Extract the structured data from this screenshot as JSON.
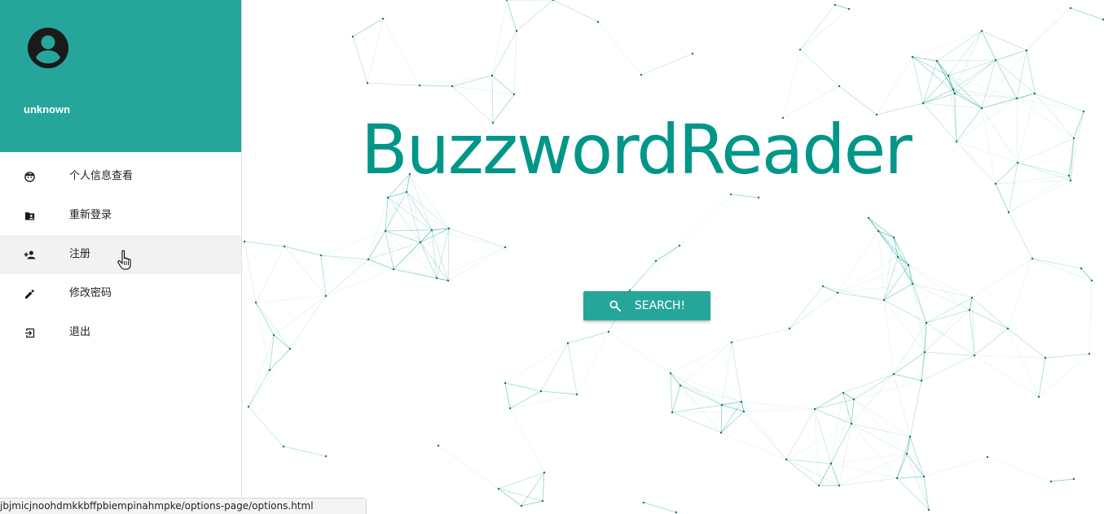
{
  "app": {
    "title": "BuzzwordReader"
  },
  "drawer": {
    "username": "unknown",
    "items": [
      {
        "label": "个人信息查看",
        "icon": "face-icon"
      },
      {
        "label": "重新登录",
        "icon": "folder-shared-icon"
      },
      {
        "label": "注册",
        "icon": "person-add-icon"
      },
      {
        "label": "修改密码",
        "icon": "edit-icon"
      },
      {
        "label": "退出",
        "icon": "exit-to-app-icon"
      }
    ],
    "hovered_item": "注册"
  },
  "main": {
    "search_button_label": "SEARCH!",
    "search_icon": "search-icon"
  },
  "status_bar": {
    "url": "jbjmicjnoohdmkkbffpbiempinahmpke/options-page/options.html"
  },
  "colors": {
    "primary": "#26a69a",
    "title": "#009688",
    "drawer_header": "#26a69a"
  }
}
